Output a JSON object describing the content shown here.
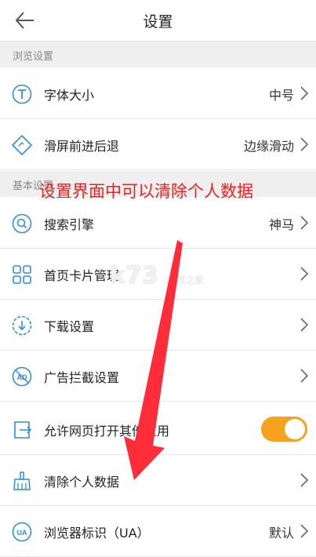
{
  "header": {
    "title": "设置",
    "back_icon": "back-arrow-icon"
  },
  "sections": {
    "browse": "浏览设置",
    "basic": "基本设置"
  },
  "rows": {
    "font_size": {
      "label": "字体大小",
      "value": "中号",
      "icon": "font-size-icon"
    },
    "swipe": {
      "label": "滑屏前进后退",
      "value": "边缘滑动",
      "icon": "swipe-icon"
    },
    "search": {
      "label": "搜索引擎",
      "value": "神马",
      "icon": "search-icon"
    },
    "cards": {
      "label": "首页卡片管理",
      "icon": "cards-icon"
    },
    "download": {
      "label": "下载设置",
      "icon": "download-icon"
    },
    "adblock": {
      "label": "广告拦截设置",
      "icon": "ad-block-icon"
    },
    "open_apps": {
      "label": "允许网页打开其他应用",
      "toggle": true,
      "icon": "open-app-icon"
    },
    "clear_data": {
      "label": "清除个人数据",
      "icon": "broom-icon"
    },
    "ua": {
      "label": "浏览器标识（UA）",
      "value": "默认",
      "icon": "ua-icon"
    }
  },
  "annotation": "设置界面中可以清除个人数据",
  "watermark": {
    "main": "k73",
    "sub": "游戏之家"
  },
  "colors": {
    "accent": "#f6a21d",
    "icon": "#2f8fd8",
    "annotation": "#ee2222"
  }
}
